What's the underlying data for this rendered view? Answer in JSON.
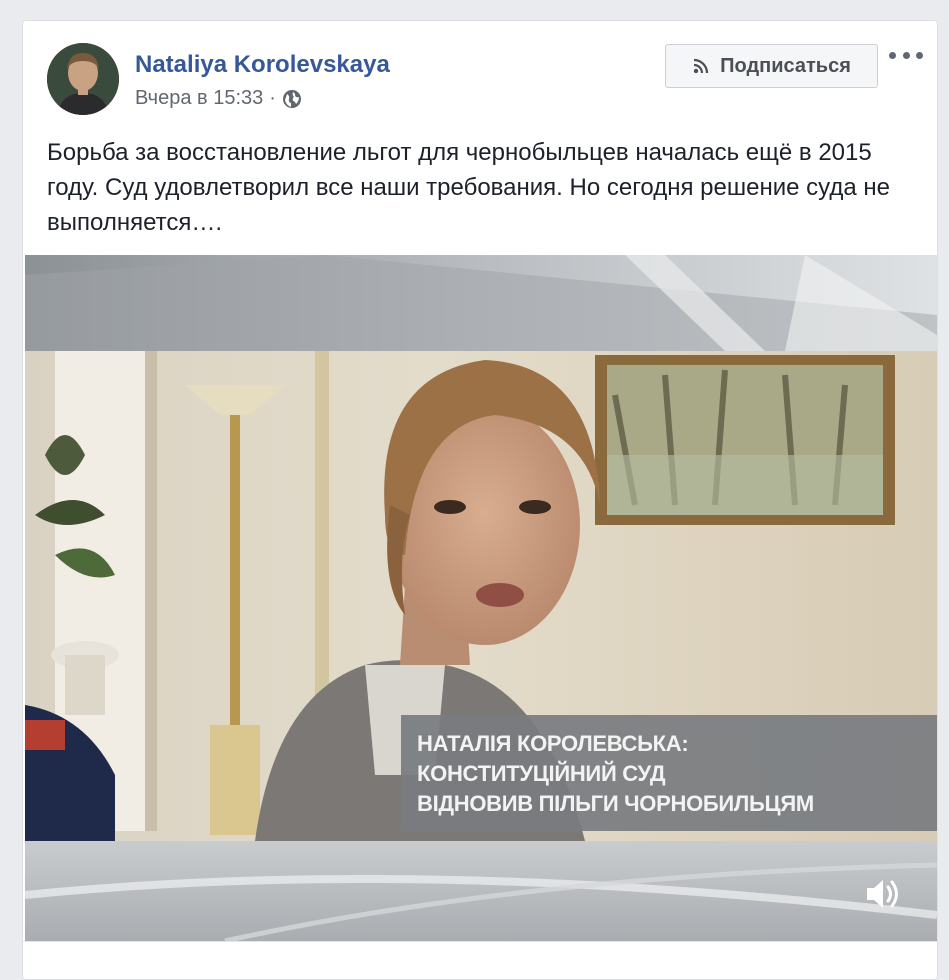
{
  "post": {
    "author": "Nataliya Korolevskaya",
    "time": "Вчера в 15:33",
    "separator": "·",
    "privacy_icon": "globe-icon",
    "subscribe_label": "Подписаться",
    "subscribe_icon": "rss-icon",
    "more_icon": "more-options-icon",
    "text": "Борьба за восстановление льгот для чернобыльцев началась ещё в 2015 году. Суд удовлетворил все наши требования. Но сегодня решение суда не выполняется…."
  },
  "video": {
    "caption_line1": "НАТАЛІЯ КОРОЛЕВСЬКА:",
    "caption_line2": "КОНСТИТУЦІЙНИЙ СУД",
    "caption_line3": "ВІДНОВИВ ПІЛЬГИ ЧОРНОБИЛЬЦЯМ",
    "volume_icon": "volume-icon"
  },
  "colors": {
    "author_link": "#365899",
    "meta_text": "#616770",
    "body_text": "#1d2129",
    "page_bg": "#e9ebee"
  }
}
